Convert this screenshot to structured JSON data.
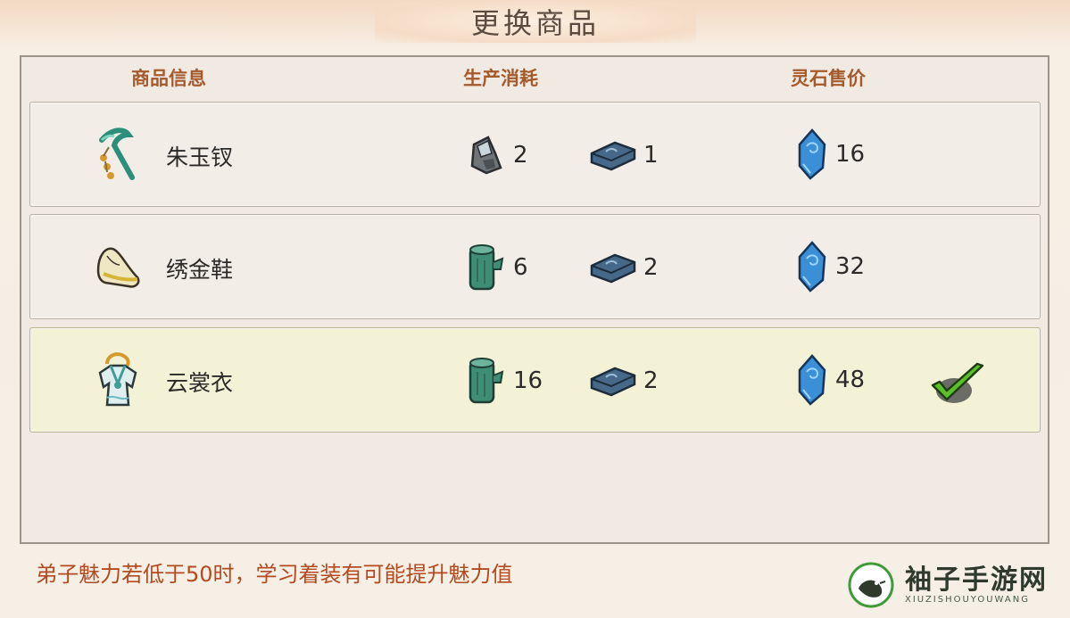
{
  "title": "更换商品",
  "columns": {
    "info": "商品信息",
    "cost": "生产消耗",
    "price": "灵石售价"
  },
  "items": [
    {
      "name": "朱玉钗",
      "icon": "jade-hairpin-icon",
      "materials": [
        {
          "icon": "stone-ore-icon",
          "qty": "2"
        },
        {
          "icon": "iron-ingot-icon",
          "qty": "1"
        }
      ],
      "price": "16",
      "selected": false
    },
    {
      "name": "绣金鞋",
      "icon": "embroidered-shoe-icon",
      "materials": [
        {
          "icon": "wood-log-icon",
          "qty": "6"
        },
        {
          "icon": "iron-ingot-icon",
          "qty": "2"
        }
      ],
      "price": "32",
      "selected": false
    },
    {
      "name": "云裳衣",
      "icon": "cloud-robe-icon",
      "materials": [
        {
          "icon": "wood-log-icon",
          "qty": "16"
        },
        {
          "icon": "iron-ingot-icon",
          "qty": "2"
        }
      ],
      "price": "48",
      "selected": true
    }
  ],
  "tip": "弟子魅力若低于50时，学习着装有可能提升魅力值",
  "watermark": {
    "main": "袖子手游网",
    "sub": "XIUZISHOUYOUWANG"
  },
  "colors": {
    "header_text": "#a55a2c",
    "tip_text": "#b34a20",
    "selected_row": "#f3f1d6",
    "check_green": "#5bbf2a"
  }
}
